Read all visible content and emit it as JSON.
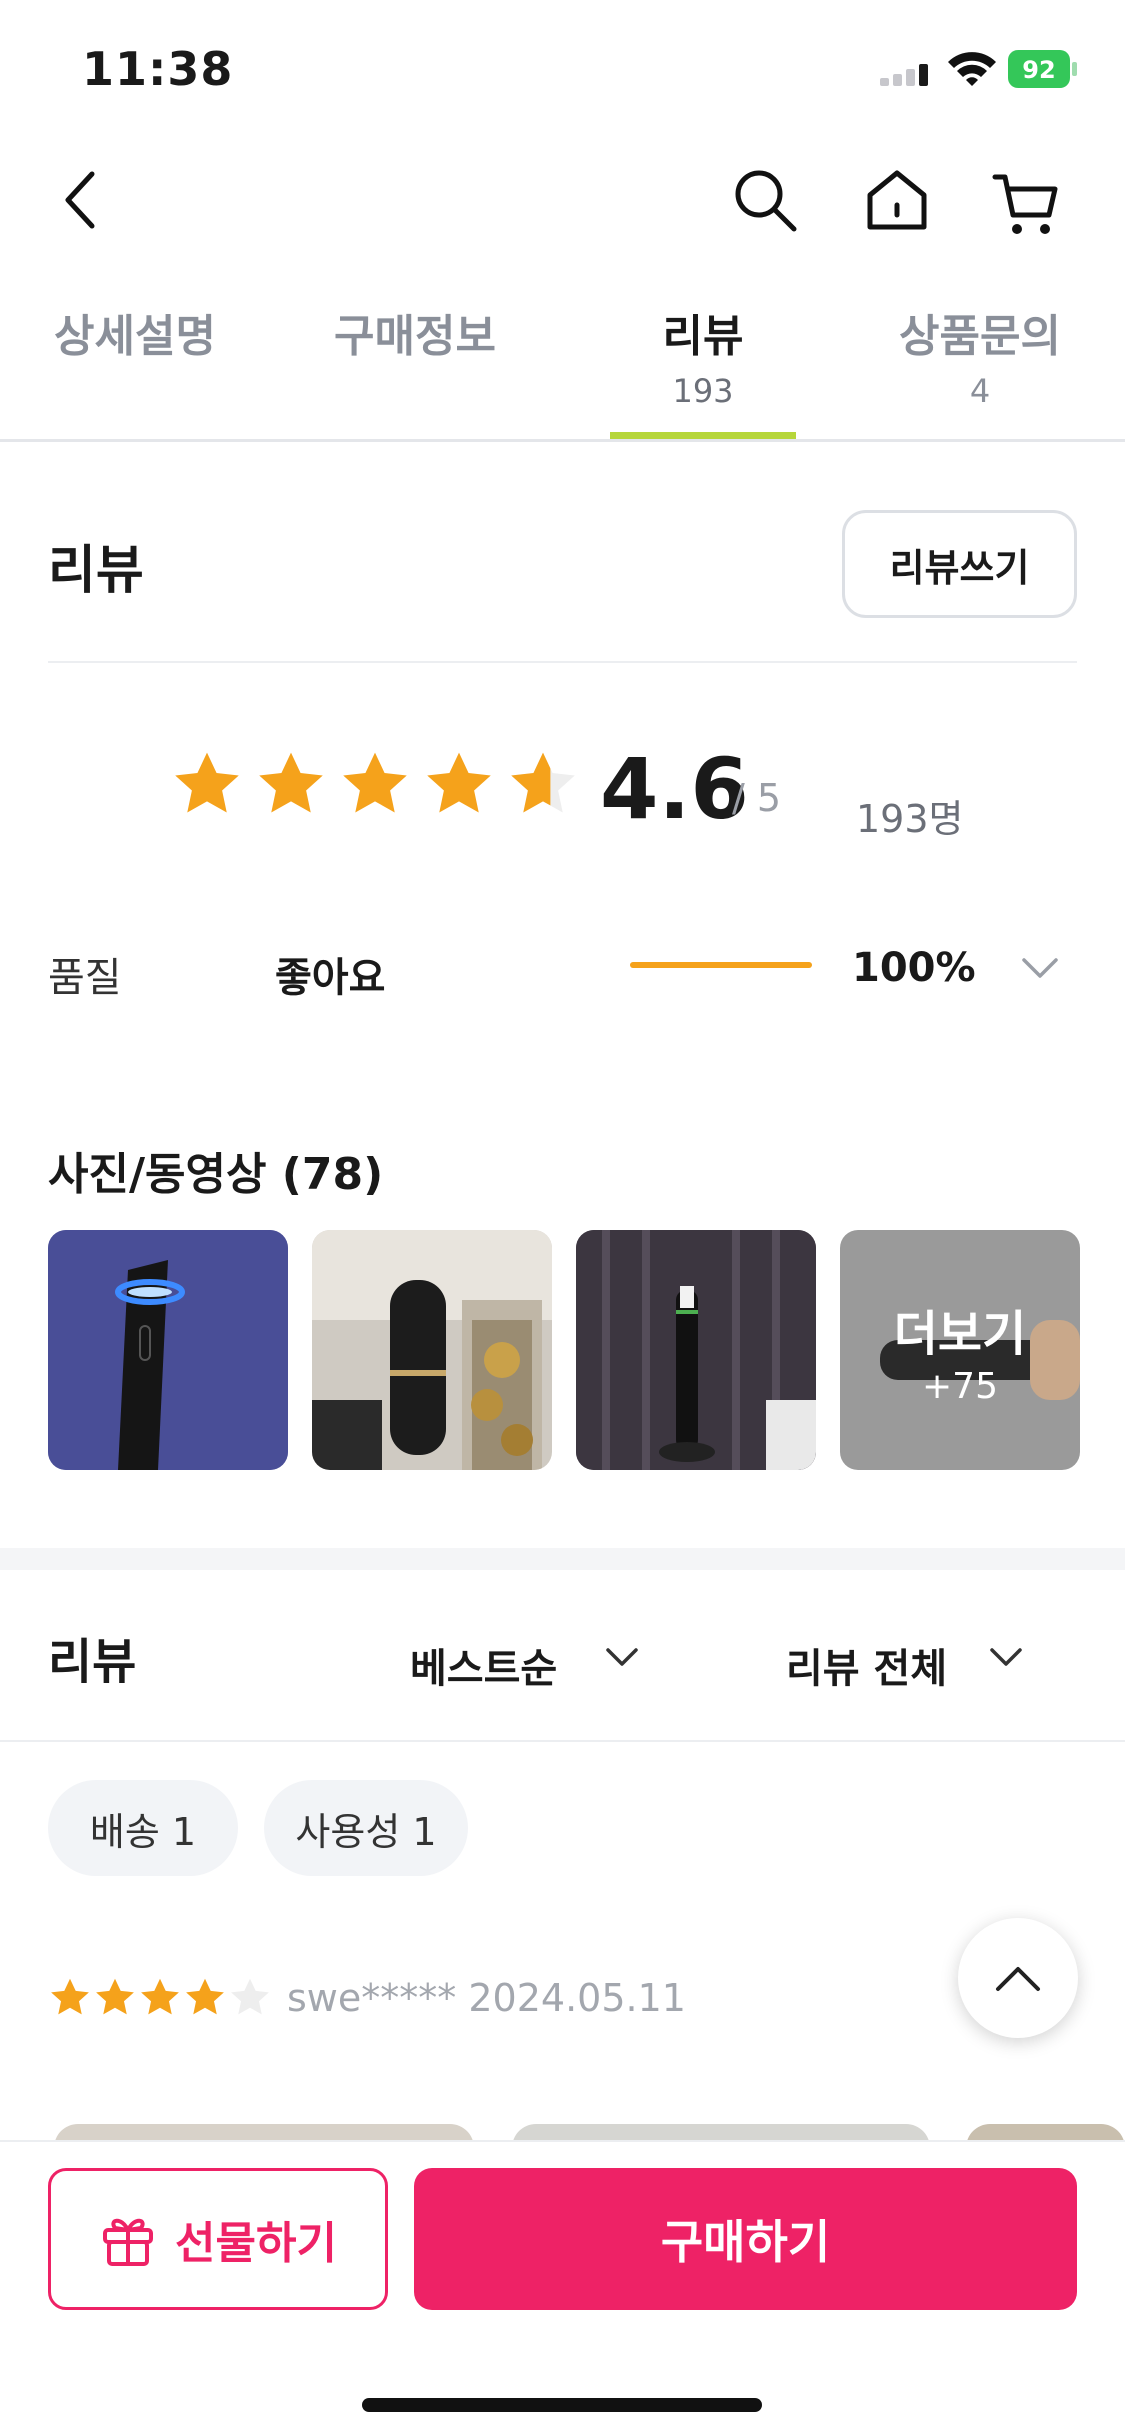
{
  "status_bar": {
    "time": "11:38",
    "battery": "92"
  },
  "tabs": [
    {
      "label": "상세설명",
      "count": ""
    },
    {
      "label": "구매정보",
      "count": ""
    },
    {
      "label": "리뷰",
      "count": "193"
    },
    {
      "label": "상품문의",
      "count": "4"
    }
  ],
  "active_tab": "리뷰",
  "review_header": {
    "title": "리뷰",
    "write_button": "리뷰쓰기"
  },
  "rating": {
    "score": "4.6",
    "max": "/ 5",
    "people": "193명",
    "stars_value": 4.6
  },
  "quality": {
    "label": "품질",
    "value": "좋아요",
    "percent": "100%",
    "fraction": 1.0
  },
  "photos": {
    "title": "사진/동영상 (78)",
    "more_label": "더보기",
    "more_count": "+75"
  },
  "review_list": {
    "title": "리뷰",
    "sort": "베스트순",
    "filter": "리뷰 전체",
    "chips": [
      "배송 1",
      "사용성 1"
    ],
    "first_review": {
      "rating": 4,
      "author": "swe*****",
      "date": "2024.05.11"
    }
  },
  "bottom": {
    "gift_label": "선물하기",
    "buy_label": "구매하기"
  },
  "colors": {
    "accent": "#ee2266",
    "star": "#f5a21b",
    "tab_underline": "#b6d63a"
  }
}
